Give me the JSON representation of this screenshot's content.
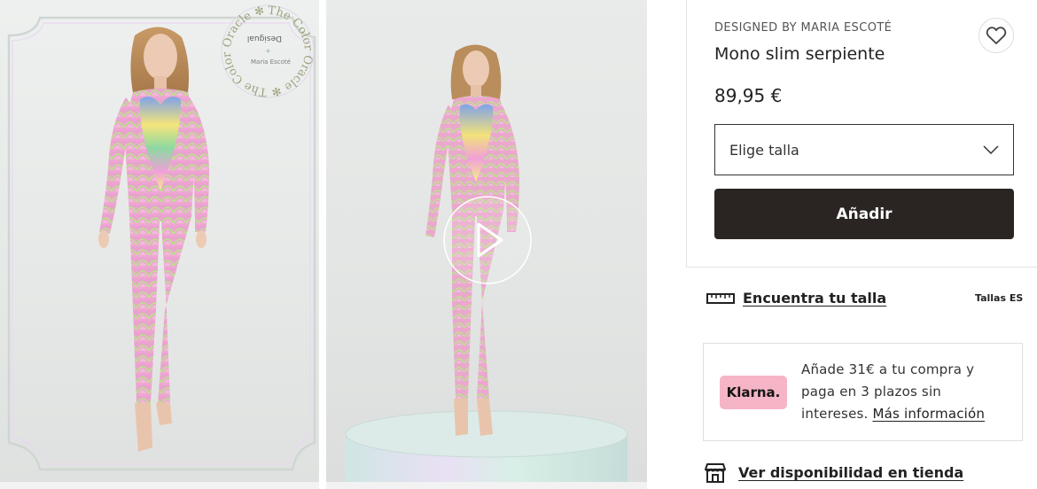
{
  "gallery": {
    "image_1_watermark": {
      "brand": "Desigual",
      "plus": "+",
      "collab": "Maria Escoté",
      "ring_text": "The Color Oracle ✻ The Color Oracle ✻"
    },
    "image_2_has_play_button": true
  },
  "product": {
    "designer": "DESIGNED BY MARIA ESCOTÉ",
    "title": "Mono slim serpiente",
    "price": "89,95 €",
    "size_placeholder": "Elige talla",
    "add_label": "Añadir"
  },
  "size_guide": {
    "link_label": "Encuentra tu talla",
    "region_label": "Tallas ES"
  },
  "klarna": {
    "brand": "Klarna.",
    "message": "Añade 31€ a tu compra y paga en 3 plazos sin intereses.",
    "link_label": "Más información"
  },
  "store": {
    "link_label": "Ver disponibilidad en tienda"
  },
  "colors": {
    "add_button_bg": "#2a2522",
    "klarna_pink": "#f6b5c6",
    "text_dark": "#222222"
  },
  "icons": [
    "heart-icon",
    "chevron-down-icon",
    "ruler-icon",
    "store-icon",
    "play-icon"
  ]
}
